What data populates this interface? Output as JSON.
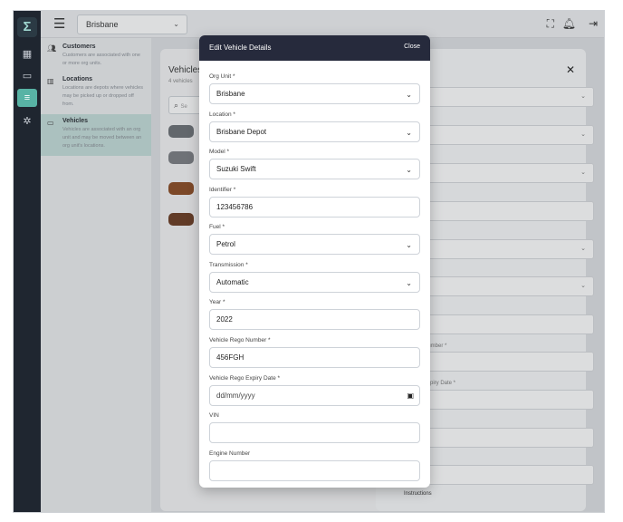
{
  "topbar": {
    "org_unit": "Brisbane"
  },
  "sidebar": {
    "items": [
      {
        "title": "Customers",
        "desc": "Customers are associated with one or more org units."
      },
      {
        "title": "Locations",
        "desc": "Locations are depots where vehicles may be picked up or dropped off from."
      },
      {
        "title": "Vehicles",
        "desc": "Vehicles are associated with an org unit and may be moved between an org unit's locations."
      }
    ]
  },
  "background": {
    "list_title": "Vehicles",
    "list_count": "4 vehicles",
    "search_placeholder": "Se",
    "panel_fields": [
      "",
      "epot",
      "ft",
      "",
      "",
      "",
      "",
      "",
      "y",
      "",
      ""
    ],
    "panel_labels": [
      "Number *",
      "Expiry Date *",
      "",
      "y"
    ],
    "instructions_label": "Instructions"
  },
  "modal": {
    "title": "Edit Vehicle Details",
    "close_label": "Close",
    "fields": [
      {
        "label": "Org Unit",
        "required": true,
        "value": "Brisbane",
        "type": "select"
      },
      {
        "label": "Location",
        "required": true,
        "value": "Brisbane Depot",
        "type": "select"
      },
      {
        "label": "Model",
        "required": true,
        "value": "Suzuki Swift",
        "type": "select"
      },
      {
        "label": "Identifier",
        "required": true,
        "value": "123456786",
        "type": "text"
      },
      {
        "label": "Fuel",
        "required": true,
        "value": "Petrol",
        "type": "select"
      },
      {
        "label": "Transmission",
        "required": true,
        "value": "Automatic",
        "type": "select"
      },
      {
        "label": "Year",
        "required": true,
        "value": "2022",
        "type": "text"
      },
      {
        "label": "Vehicle Rego Number",
        "required": true,
        "value": "456FGH",
        "type": "text"
      },
      {
        "label": "Vehicle Rego Expiry Date",
        "required": true,
        "value": "dd/mm/yyyy",
        "type": "date"
      },
      {
        "label": "VIN",
        "required": false,
        "value": "",
        "type": "text"
      },
      {
        "label": "Engine Number",
        "required": false,
        "value": "",
        "type": "text"
      }
    ]
  }
}
